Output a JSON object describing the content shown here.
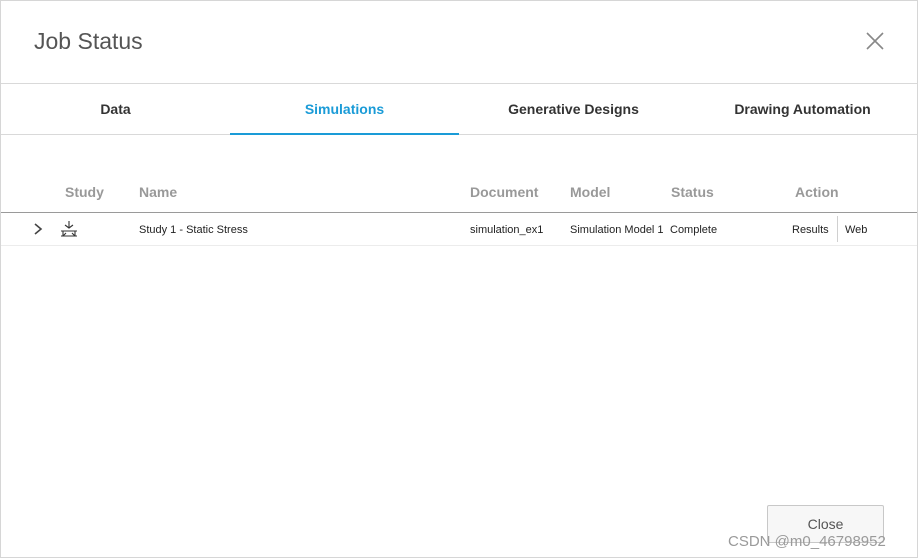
{
  "dialog": {
    "title": "Job Status"
  },
  "tabs": [
    {
      "label": "Data",
      "active": false
    },
    {
      "label": "Simulations",
      "active": true
    },
    {
      "label": "Generative Designs",
      "active": false
    },
    {
      "label": "Drawing Automation",
      "active": false
    }
  ],
  "table": {
    "columns": [
      "Study",
      "Name",
      "Document",
      "Model",
      "Status",
      "Action"
    ],
    "rows": [
      {
        "study_icon": "static-stress-icon",
        "name": "Study 1 - Static Stress",
        "document": "simulation_ex1",
        "model": "Simulation Model 1",
        "status": "Complete",
        "actions": [
          "Results",
          "Web"
        ]
      }
    ]
  },
  "footer": {
    "close_label": "Close"
  },
  "watermark": "CSDN @m0_46798952",
  "icons": {
    "close": "close-icon",
    "expand": "chevron-right-icon"
  },
  "colors": {
    "accent": "#1a9bd7",
    "header_text": "#999999"
  }
}
